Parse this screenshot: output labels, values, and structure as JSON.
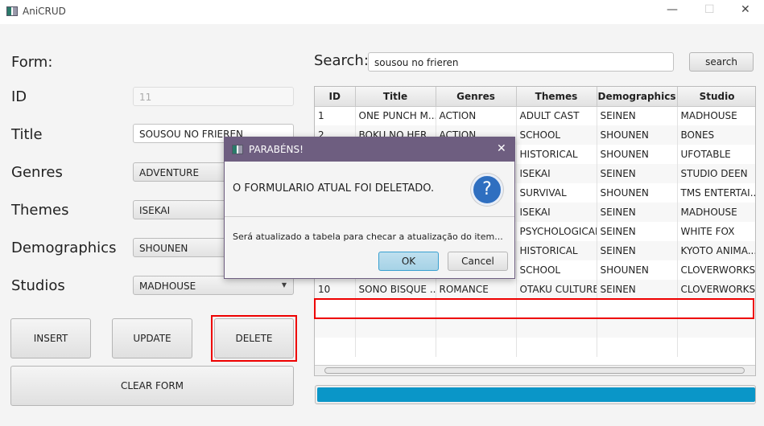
{
  "window": {
    "title": "AniCRUD",
    "minimize": "—",
    "maximize": "☐",
    "close": "✕"
  },
  "form": {
    "heading": "Form:",
    "id_label": "ID",
    "id_value": "11",
    "title_label": "Title",
    "title_value": "SOUSOU NO FRIEREN",
    "genres_label": "Genres",
    "genres_value": "ADVENTURE",
    "themes_label": "Themes",
    "themes_value": "ISEKAI",
    "demographics_label": "Demographics",
    "demographics_value": "SHOUNEN",
    "studios_label": "Studios",
    "studios_value": "MADHOUSE"
  },
  "buttons": {
    "insert": "INSERT",
    "update": "UPDATE",
    "delete": "DELETE",
    "clear": "CLEAR FORM"
  },
  "search": {
    "label": "Search:",
    "value": "sousou no frieren",
    "button": "search"
  },
  "table": {
    "headers": [
      "ID",
      "Title",
      "Genres",
      "Themes",
      "Demographics",
      "Studio"
    ],
    "rows": [
      [
        "1",
        "ONE PUNCH M...",
        "ACTION",
        "ADULT CAST",
        "SEINEN",
        "MADHOUSE"
      ],
      [
        "2",
        "BOKU NO HER...",
        "ACTION",
        "SCHOOL",
        "SHOUNEN",
        "BONES"
      ],
      [
        "",
        "",
        "",
        "HISTORICAL",
        "SHOUNEN",
        "UFOTABLE"
      ],
      [
        "",
        "",
        "",
        "ISEKAI",
        "SEINEN",
        "STUDIO DEEN"
      ],
      [
        "",
        "",
        "",
        "SURVIVAL",
        "SHOUNEN",
        "TMS ENTERTAI..."
      ],
      [
        "",
        "",
        "",
        "ISEKAI",
        "SEINEN",
        "MADHOUSE"
      ],
      [
        "",
        "",
        "",
        "PSYCHOLOGICAL",
        "SEINEN",
        "WHITE FOX"
      ],
      [
        "",
        "",
        "",
        "HISTORICAL",
        "SEINEN",
        "KYOTO ANIMA..."
      ],
      [
        "",
        "",
        "",
        "SCHOOL",
        "SHOUNEN",
        "CLOVERWORKS"
      ],
      [
        "10",
        "SONO BISQUE ...",
        "ROMANCE",
        "OTAKU CULTURE",
        "SEINEN",
        "CLOVERWORKS"
      ],
      [
        "",
        "",
        "",
        "",
        "",
        ""
      ],
      [
        "",
        "",
        "",
        "",
        "",
        ""
      ],
      [
        "",
        "",
        "",
        "",
        " ",
        ""
      ]
    ]
  },
  "progress": {
    "value": 1.0,
    "color": "#0a96c8"
  },
  "dialog": {
    "title": "PARABÉNS!",
    "header": "O FORMULARIO ATUAL FOI DELETADO.",
    "content": "Será atualizado a tabela para checar a atualização do item...",
    "ok": "OK",
    "cancel": "Cancel",
    "close": "✕",
    "icon": "?"
  }
}
